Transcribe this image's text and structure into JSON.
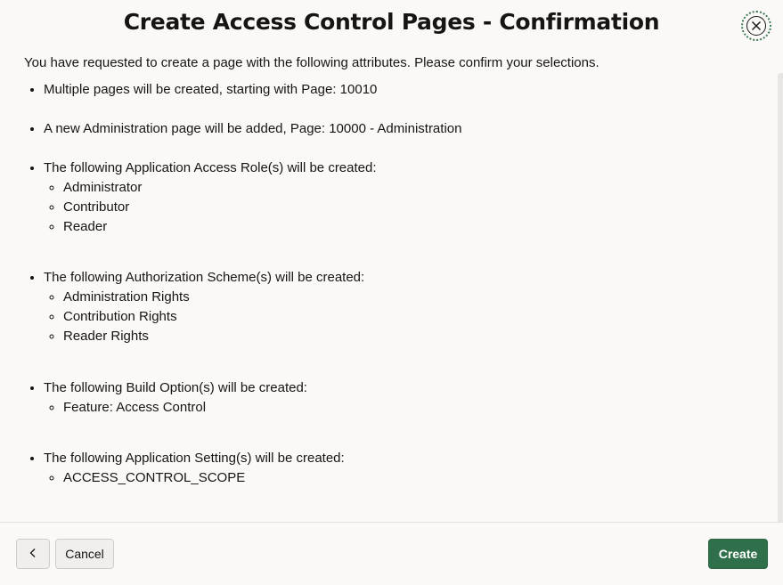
{
  "dialog": {
    "title": "Create Access Control Pages - Confirmation",
    "close_icon": "close-icon"
  },
  "body": {
    "intro": "You have requested to create a page with the following attributes. Please confirm your selections.",
    "pages_item": "Multiple pages will be created, starting with Page: 10010",
    "admin_item": "A new Administration page will be added, Page: 10000 - Administration",
    "roles": {
      "label": "The following Application Access Role(s) will be created:",
      "items": [
        "Administrator",
        "Contributor",
        "Reader"
      ]
    },
    "schemes": {
      "label": "The following Authorization Scheme(s) will be created:",
      "items": [
        "Administration Rights",
        "Contribution Rights",
        "Reader Rights"
      ]
    },
    "build_options": {
      "label": "The following Build Option(s) will be created:",
      "items": [
        "Feature: Access Control"
      ]
    },
    "settings": {
      "label": "The following Application Setting(s) will be created:",
      "items": [
        "ACCESS_CONTROL_SCOPE"
      ]
    }
  },
  "footer": {
    "prev_icon": "chevron-left-icon",
    "cancel_label": "Cancel",
    "create_label": "Create"
  },
  "colors": {
    "accent": "#2f6f4a",
    "background": "#fbf9f8"
  }
}
